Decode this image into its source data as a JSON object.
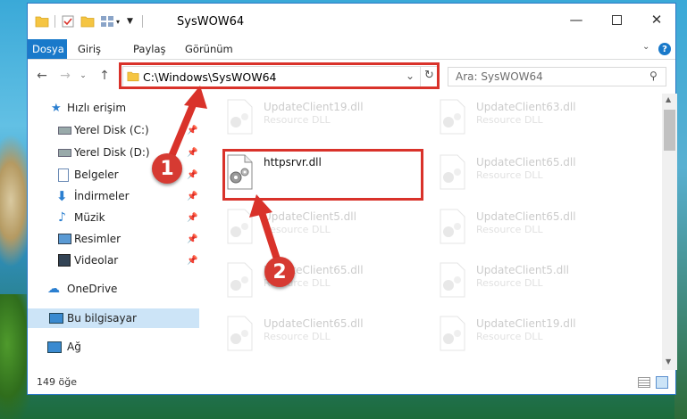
{
  "window": {
    "title": "SysWOW64"
  },
  "ribbon": {
    "tabs": [
      "Dosya",
      "Giriş",
      "Paylaş",
      "Görünüm"
    ]
  },
  "nav": {
    "address": "C:\\Windows\\SysWOW64",
    "search_placeholder": "Ara: SysWOW64"
  },
  "sidebar": {
    "items": [
      {
        "label": "Hızlı erişim",
        "icon": "star-icon"
      },
      {
        "label": "Yerel Disk (C:)",
        "icon": "drive-icon"
      },
      {
        "label": "Yerel Disk (D:)",
        "icon": "drive-icon"
      },
      {
        "label": "Belgeler",
        "icon": "documents-icon"
      },
      {
        "label": "İndirmeler",
        "icon": "download-icon"
      },
      {
        "label": "Müzik",
        "icon": "music-icon"
      },
      {
        "label": "Resimler",
        "icon": "pictures-icon"
      },
      {
        "label": "Videolar",
        "icon": "video-icon"
      },
      {
        "label": "OneDrive",
        "icon": "cloud-icon"
      },
      {
        "label": "Bu bilgisayar",
        "icon": "computer-icon"
      },
      {
        "label": "Ağ",
        "icon": "network-icon"
      }
    ]
  },
  "files": [
    {
      "name": "UpdateClient19.dll",
      "type": "Resource DLL"
    },
    {
      "name": "UpdateClient63.dll",
      "type": "Resource DLL"
    },
    {
      "name": "httpsrvr.dll",
      "type": ""
    },
    {
      "name": "UpdateClient65.dll",
      "type": "Resource DLL"
    },
    {
      "name": "UpdateClient5.dll",
      "type": "Resource DLL"
    },
    {
      "name": "UpdateClient65.dll",
      "type": "Resource DLL"
    },
    {
      "name": "UpdateClient65.dll",
      "type": "Resource DLL"
    },
    {
      "name": "UpdateClient5.dll",
      "type": "Resource DLL"
    },
    {
      "name": "UpdateClient65.dll",
      "type": "Resource DLL"
    },
    {
      "name": "UpdateClient19.dll",
      "type": "Resource DLL"
    }
  ],
  "status": {
    "count": "149 öğe"
  },
  "annotations": {
    "step1": "1",
    "step2": "2"
  },
  "colors": {
    "accent": "#1979ca",
    "highlight": "#d9322a"
  }
}
